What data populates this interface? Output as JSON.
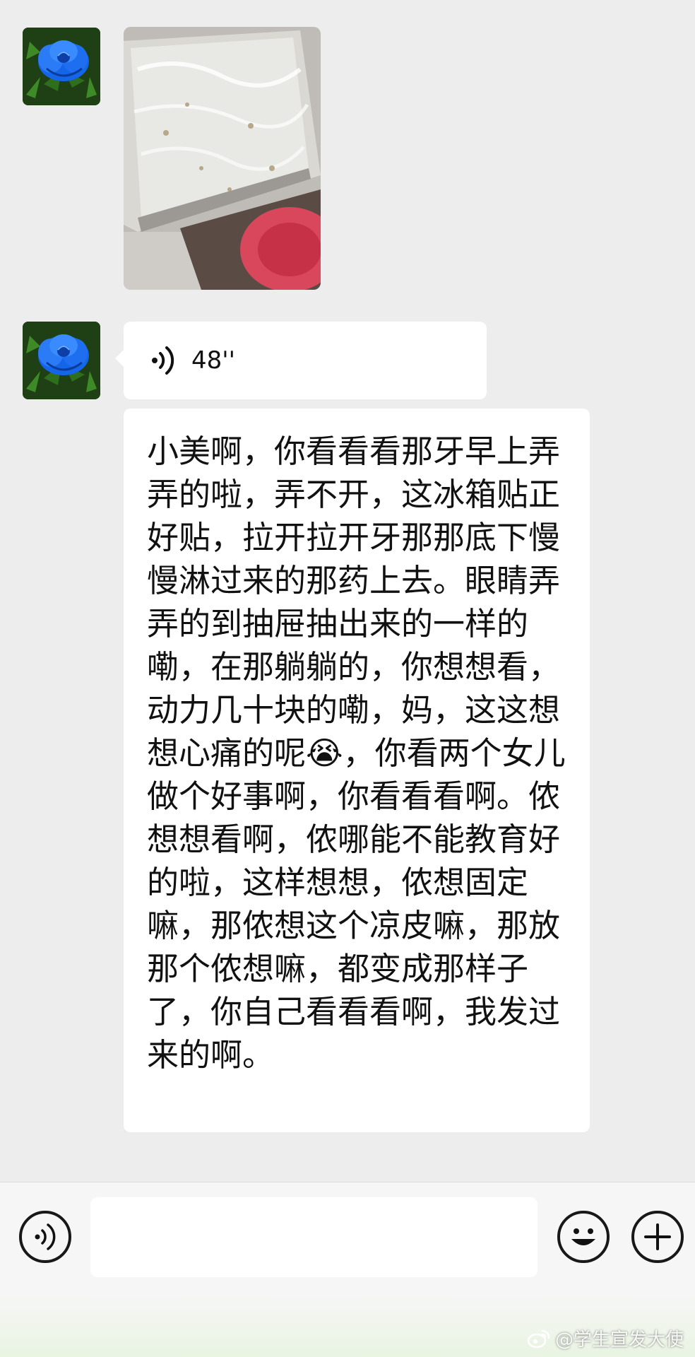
{
  "messages": [
    {
      "type": "image",
      "sender_avatar": "blue-rose-avatar",
      "image_description_icon": "food-container-photo"
    },
    {
      "type": "voice",
      "sender_avatar": "blue-rose-avatar",
      "icon": "voice-wave-icon",
      "duration": "48''"
    },
    {
      "type": "text",
      "text": "小美啊，你看看看那牙早上弄弄的啦，弄不开，这冰箱贴正好贴，拉开拉开牙那那底下慢慢淋过来的那药上去。眼睛弄弄的到抽屉抽出来的一样的嘞，在那躺躺的，你想想看，动力几十块的嘞，妈，这这想想心痛的呢😭，你看两个女儿做个好事啊，你看看看啊。侬想想看啊，侬哪能不能教育好的啦，这样想想，侬想固定嘛，那侬想这个凉皮嘛，那放那个侬想嘛，都变成那样子了，你自己看看看啊，我发过来的啊。"
    }
  ],
  "input_bar": {
    "voice_button_icon": "voice-input-icon",
    "input_value": "",
    "emoji_button_icon": "smiley-icon",
    "more_button_icon": "plus-icon"
  },
  "watermark": {
    "icon": "weibo-icon",
    "text": "@学生宣发大使"
  },
  "colors": {
    "chat_background": "#ededed",
    "bubble_background": "#ffffff",
    "input_bar_background": "#f6f6f6"
  }
}
